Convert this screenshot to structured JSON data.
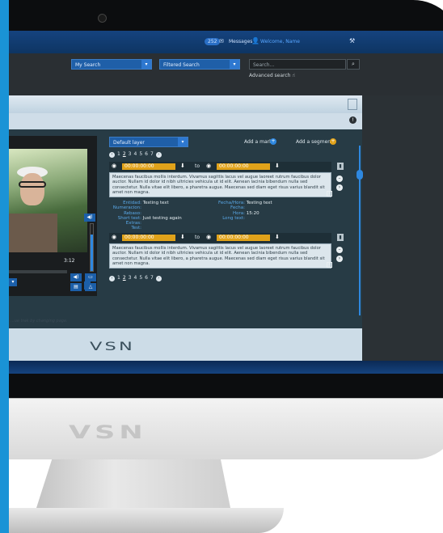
{
  "topbar": {
    "message_count": "252",
    "messages_label": "Messages",
    "welcome_label": "Welcome, Name"
  },
  "search": {
    "my_search": "My Search",
    "filtered_search": "Filtered Search",
    "placeholder": "Search...",
    "advanced": "Advanced search"
  },
  "annotation": {
    "layer": "Default layer",
    "add_mark": "Add a mark",
    "add_segment": "Add a segment",
    "pages": [
      "1",
      "2",
      "3",
      "4",
      "5",
      "6",
      "7"
    ],
    "active_page_index": 1,
    "segments": [
      {
        "start": "00:00:00:00",
        "to_label": "to",
        "end": "00:00:00:00",
        "text": "Maecenas faucibus mollis interdum. Vivamus sagittis lacus vel augue laoreet rutrum faucibus dolor auctor. Nullam id dolor id nibh ultricies vehicula ut id elit. Aenean lacinia bibendum nulla sed consectetur. Nulla vitae elit libero, a pharetra augue. Maecenas sed diam eget risus varius blandit sit amet non magna."
      },
      {
        "start": "00:00:00:00",
        "to_label": "to",
        "end": "00:00:00:00",
        "text": "Maecenas faucibus mollis interdum. Vivamus sagittis lacus vel augue laoreet rutrum faucibus dolor auctor. Nullam id dolor id nibh ultricies vehicula ut id elit. Aenean lacinia bibendum nulla sed consectetur. Nulla vitae elit libero, a pharetra augue. Maecenas sed diam eget risus varius blandit sit amet non magna."
      }
    ],
    "meta_left": [
      {
        "k": "Entidad:",
        "v": "Testing text"
      },
      {
        "k": "Numeracion:",
        "v": ""
      },
      {
        "k": "Rebaso:",
        "v": ""
      },
      {
        "k": "Short text:",
        "v": "Just testing again"
      },
      {
        "k": "Extras:",
        "v": ""
      },
      {
        "k": "Test:",
        "v": ""
      }
    ],
    "meta_right": [
      {
        "k": "Fecha/Hora:",
        "v": "Testing text"
      },
      {
        "k": "Fecha:",
        "v": ""
      },
      {
        "k": "Hora:",
        "v": "15:20"
      },
      {
        "k": "Long text:",
        "v": ""
      }
    ]
  },
  "player": {
    "time": "3:12"
  },
  "hint": "...ue trak by changing page.",
  "brand": {
    "screen_logo": "VSN",
    "chin_logo": "VSN"
  },
  "colors": {
    "accent": "#2e88e0",
    "timecode": "#e0a21a",
    "topbar": "#15437f"
  }
}
